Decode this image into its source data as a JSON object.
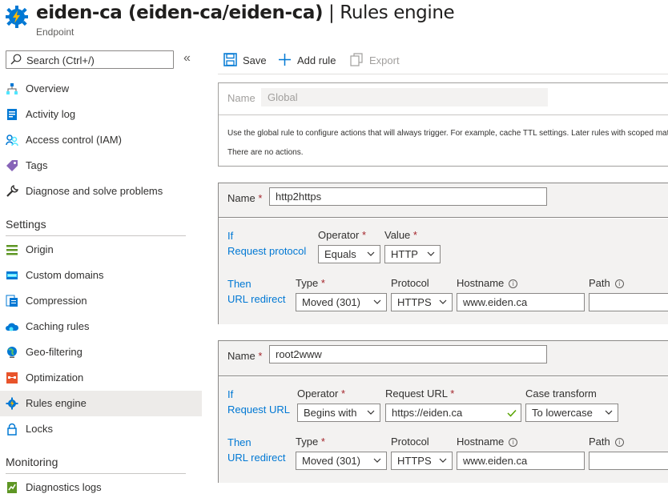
{
  "header": {
    "title_main": "eiden-ca (eiden-ca/eiden-ca)",
    "title_sep": " | ",
    "title_page": "Rules engine",
    "subtitle": "Endpoint"
  },
  "sidebar": {
    "search_placeholder": "Search (Ctrl+/)",
    "collapse": "«",
    "items_top": [
      {
        "label": "Overview",
        "icon": "overview-icon"
      },
      {
        "label": "Activity log",
        "icon": "activity-log-icon"
      },
      {
        "label": "Access control (IAM)",
        "icon": "access-control-icon"
      },
      {
        "label": "Tags",
        "icon": "tag-icon"
      },
      {
        "label": "Diagnose and solve problems",
        "icon": "wrench-icon"
      }
    ],
    "settings_header": "Settings",
    "settings_items": [
      {
        "label": "Origin",
        "icon": "origin-icon"
      },
      {
        "label": "Custom domains",
        "icon": "custom-domains-icon"
      },
      {
        "label": "Compression",
        "icon": "compression-icon"
      },
      {
        "label": "Caching rules",
        "icon": "caching-icon"
      },
      {
        "label": "Geo-filtering",
        "icon": "globe-icon"
      },
      {
        "label": "Optimization",
        "icon": "optimization-icon"
      },
      {
        "label": "Rules engine",
        "icon": "gear-icon"
      },
      {
        "label": "Locks",
        "icon": "lock-icon"
      }
    ],
    "monitoring_header": "Monitoring",
    "monitoring_items": [
      {
        "label": "Diagnostics logs",
        "icon": "diagnostics-logs-icon"
      }
    ]
  },
  "toolbar": {
    "save": "Save",
    "add_rule": "Add rule",
    "export": "Export"
  },
  "global_rule": {
    "name_label": "Name",
    "name_value": "Global",
    "description": "Use the global rule to configure actions that will always trigger. For example, cache TTL settings. Later rules with scoped match",
    "no_actions": "There are no actions."
  },
  "rule1": {
    "name_label": "Name",
    "required": "*",
    "name_value": "http2https",
    "if_label": "If",
    "condition_label": "Request protocol",
    "operator_label": "Operator",
    "operator_value": "Equals",
    "value_label": "Value",
    "value_value": "HTTP",
    "then_label": "Then",
    "action_label": "URL redirect",
    "type_label": "Type",
    "type_value": "Moved (301)",
    "protocol_label": "Protocol",
    "protocol_value": "HTTPS",
    "hostname_label": "Hostname",
    "hostname_value": "www.eiden.ca",
    "path_label": "Path",
    "path_value": ""
  },
  "rule2": {
    "name_label": "Name",
    "required": "*",
    "name_value": "root2www",
    "if_label": "If",
    "condition_label": "Request URL",
    "operator_label": "Operator",
    "operator_value": "Begins with",
    "request_url_label": "Request URL",
    "request_url_value": "https://eiden.ca",
    "case_label": "Case transform",
    "case_value": "To lowercase",
    "then_label": "Then",
    "action_label": "URL redirect",
    "type_label": "Type",
    "type_value": "Moved (301)",
    "protocol_label": "Protocol",
    "protocol_value": "HTTPS",
    "hostname_label": "Hostname",
    "hostname_value": "www.eiden.ca",
    "path_label": "Path",
    "path_value": ""
  }
}
